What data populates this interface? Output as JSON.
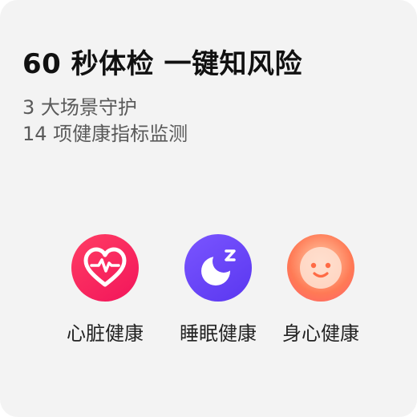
{
  "header": {
    "title": "60 秒体检 一键知风险",
    "subtitle_line1": "3 大场景守护",
    "subtitle_line2": "14 项健康指标监测"
  },
  "features": [
    {
      "label": "心脏健康",
      "icon": "heart-ecg-icon",
      "color": "#f2155b"
    },
    {
      "label": "睡眠健康",
      "icon": "moon-sleep-icon",
      "color": "#6a46f6"
    },
    {
      "label": "身心健康",
      "icon": "smiley-face-icon",
      "color": "#ff7a55"
    }
  ]
}
